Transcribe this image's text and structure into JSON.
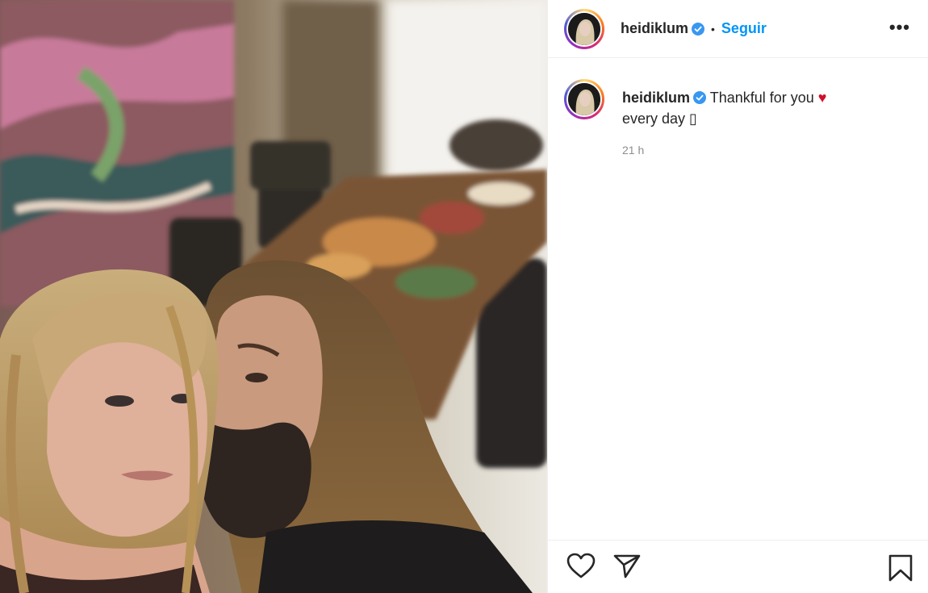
{
  "post": {
    "username": "heidiklum",
    "follow_label": "Seguir",
    "separator": "•",
    "more_label": "•••",
    "caption": {
      "username": "heidiklum",
      "text_line1": "Thankful for you",
      "heart": "♥",
      "text_line2": "every day ▯"
    },
    "timestamp": "21 h"
  },
  "icons": {
    "verified": "verified-badge-icon",
    "like": "heart-outline-icon",
    "share": "paper-plane-icon",
    "save": "bookmark-icon"
  },
  "colors": {
    "accent": "#0095f6",
    "heart": "#d10f2a",
    "muted": "#8e8e8e"
  }
}
